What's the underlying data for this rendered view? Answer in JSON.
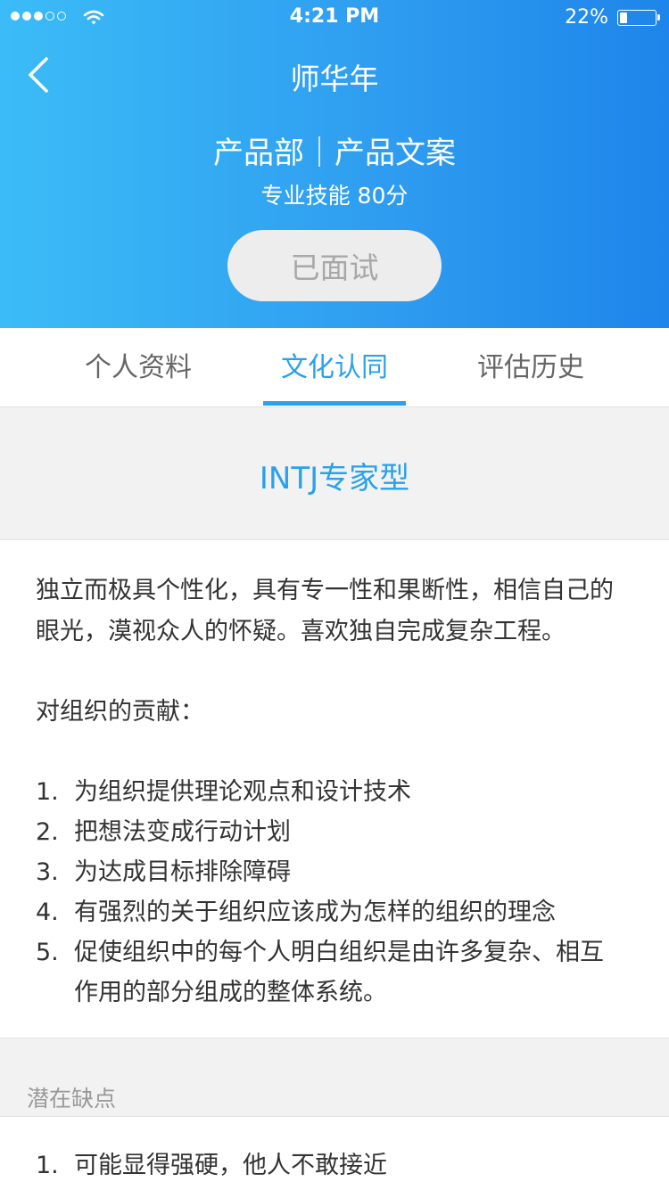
{
  "status_bar": {
    "time": "4:21 PM",
    "battery_pct": "22%",
    "battery_level": 0.22,
    "signal_bars_filled": 3,
    "signal_bars_total": 5
  },
  "header": {
    "title": "师华年",
    "department_role": "产品部｜产品文案",
    "skill_score": "专业技能 80分",
    "status_button": "已面试"
  },
  "tabs": [
    {
      "label": "个人资料",
      "active": false
    },
    {
      "label": "文化认同",
      "active": true
    },
    {
      "label": "评估历史",
      "active": false
    }
  ],
  "personality": {
    "type_title": "INTJ专家型",
    "description_lines": [
      "独立而极具个性化，具有专一性和果断性，相信自己的",
      "眼光，漠视众人的怀疑。喜欢独自完成复杂工程。"
    ],
    "contribution_heading": "对组织的贡献：",
    "contributions": [
      {
        "num": "1.",
        "text": "为组织提供理论观点和设计技术"
      },
      {
        "num": "2.",
        "text": "把想法变成行动计划"
      },
      {
        "num": "3.",
        "text": "为达成目标排除障碍"
      },
      {
        "num": "4.",
        "text": "有强烈的关于组织应该成为怎样的组织的理念"
      },
      {
        "num": "5.",
        "text": "促使组织中的每个人明白组织是由许多复杂、相互",
        "continuation": "作用的部分组成的整体系统。"
      }
    ]
  },
  "weaknesses": {
    "label": "潜在缺点",
    "items": [
      {
        "num": "1.",
        "text": "可能显得强硬，他人不敢接近"
      }
    ]
  },
  "colors": {
    "accent": "#2aa1ec",
    "header_gradient_start": "#3bbcf7",
    "header_gradient_end": "#1e85ea"
  }
}
